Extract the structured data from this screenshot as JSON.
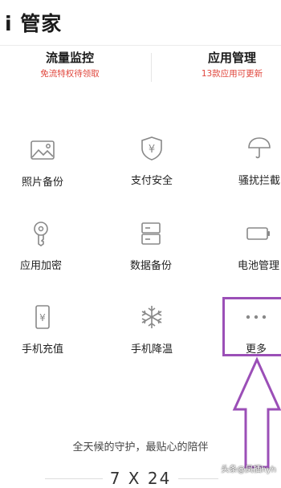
{
  "header": {
    "title": "i 管家"
  },
  "summary": {
    "left": {
      "title": "流量监控",
      "subtitle": "免流特权待领取"
    },
    "right": {
      "title": "应用管理",
      "subtitle": "13款应用可更新"
    }
  },
  "tools": [
    {
      "label": "照片备份",
      "icon": "photo-icon"
    },
    {
      "label": "支付安全",
      "icon": "payment-shield-icon"
    },
    {
      "label": "骚扰拦截",
      "icon": "umbrella-icon"
    },
    {
      "label": "应用加密",
      "icon": "key-lock-icon"
    },
    {
      "label": "数据备份",
      "icon": "server-icon"
    },
    {
      "label": "电池管理",
      "icon": "battery-icon"
    },
    {
      "label": "手机充值",
      "icon": "phone-yuan-icon"
    },
    {
      "label": "手机降温",
      "icon": "snowflake-icon"
    },
    {
      "label": "更多",
      "icon": "more-dots-icon"
    }
  ],
  "footer": {
    "tagline": "全天候的守护，最贴心的陪伴",
    "big": "7 X 24"
  },
  "watermark": "头条@凤栖hyh",
  "colors": {
    "accent_red": "#e0463c",
    "icon_gray": "#888888",
    "annotation_purple": "#9b4fb7"
  }
}
